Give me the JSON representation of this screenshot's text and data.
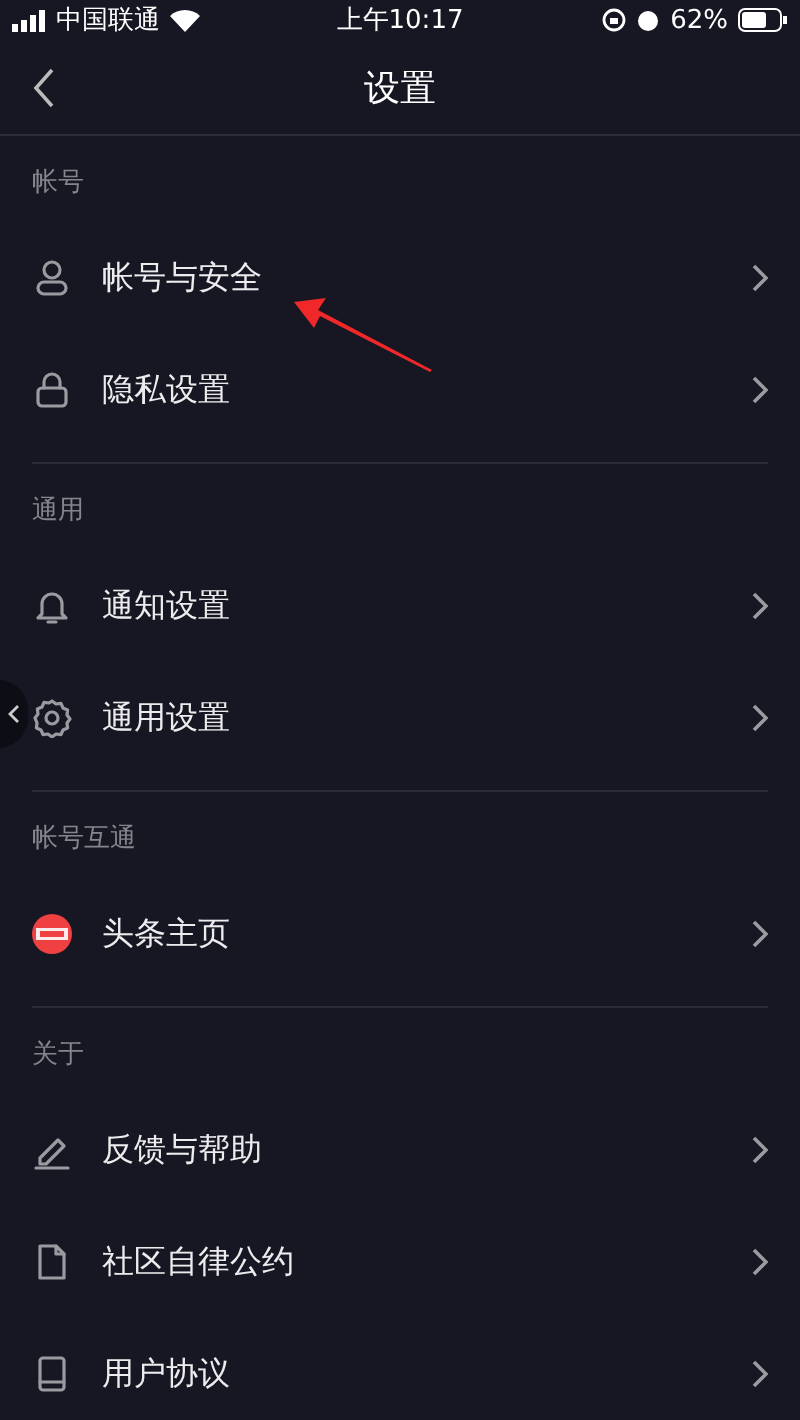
{
  "status_bar": {
    "carrier": "中国联通",
    "time": "上午10:17",
    "battery": "62%"
  },
  "nav": {
    "title": "设置"
  },
  "sections": [
    {
      "header": "帐号",
      "items": [
        {
          "label": "帐号与安全"
        },
        {
          "label": "隐私设置"
        }
      ]
    },
    {
      "header": "通用",
      "items": [
        {
          "label": "通知设置"
        },
        {
          "label": "通用设置"
        }
      ]
    },
    {
      "header": "帐号互通",
      "items": [
        {
          "label": "头条主页"
        }
      ]
    },
    {
      "header": "关于",
      "items": [
        {
          "label": "反馈与帮助"
        },
        {
          "label": "社区自律公约"
        },
        {
          "label": "用户协议"
        }
      ]
    }
  ]
}
